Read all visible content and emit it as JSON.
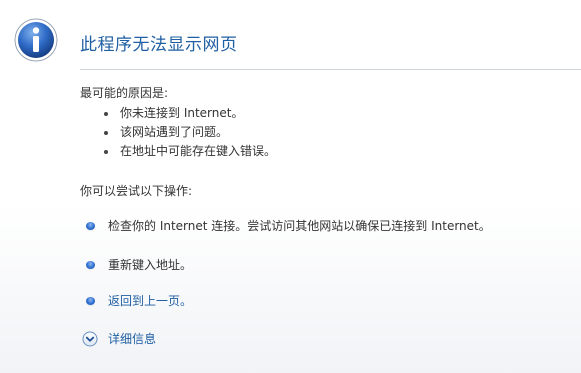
{
  "header": {
    "title": "此程序无法显示网页"
  },
  "causes": {
    "title": "最可能的原因是:",
    "items": [
      "你未连接到 Internet。",
      "该网站遇到了问题。",
      "在地址中可能存在键入错误。"
    ]
  },
  "actions": {
    "title": "你可以尝试以下操作:",
    "items": [
      "检查你的 Internet 连接。尝试访问其他网站以确保已连接到 Internet。",
      "重新键入地址。",
      "返回到上一页。"
    ]
  },
  "details": {
    "label": "详细信息"
  },
  "colors": {
    "accent": "#1f5fa3",
    "text": "#333333",
    "divider": "#cfd4da"
  },
  "icons": {
    "header": "info-icon",
    "action_bullet": "blue-bullet-icon",
    "details": "expand-chevron-icon"
  }
}
